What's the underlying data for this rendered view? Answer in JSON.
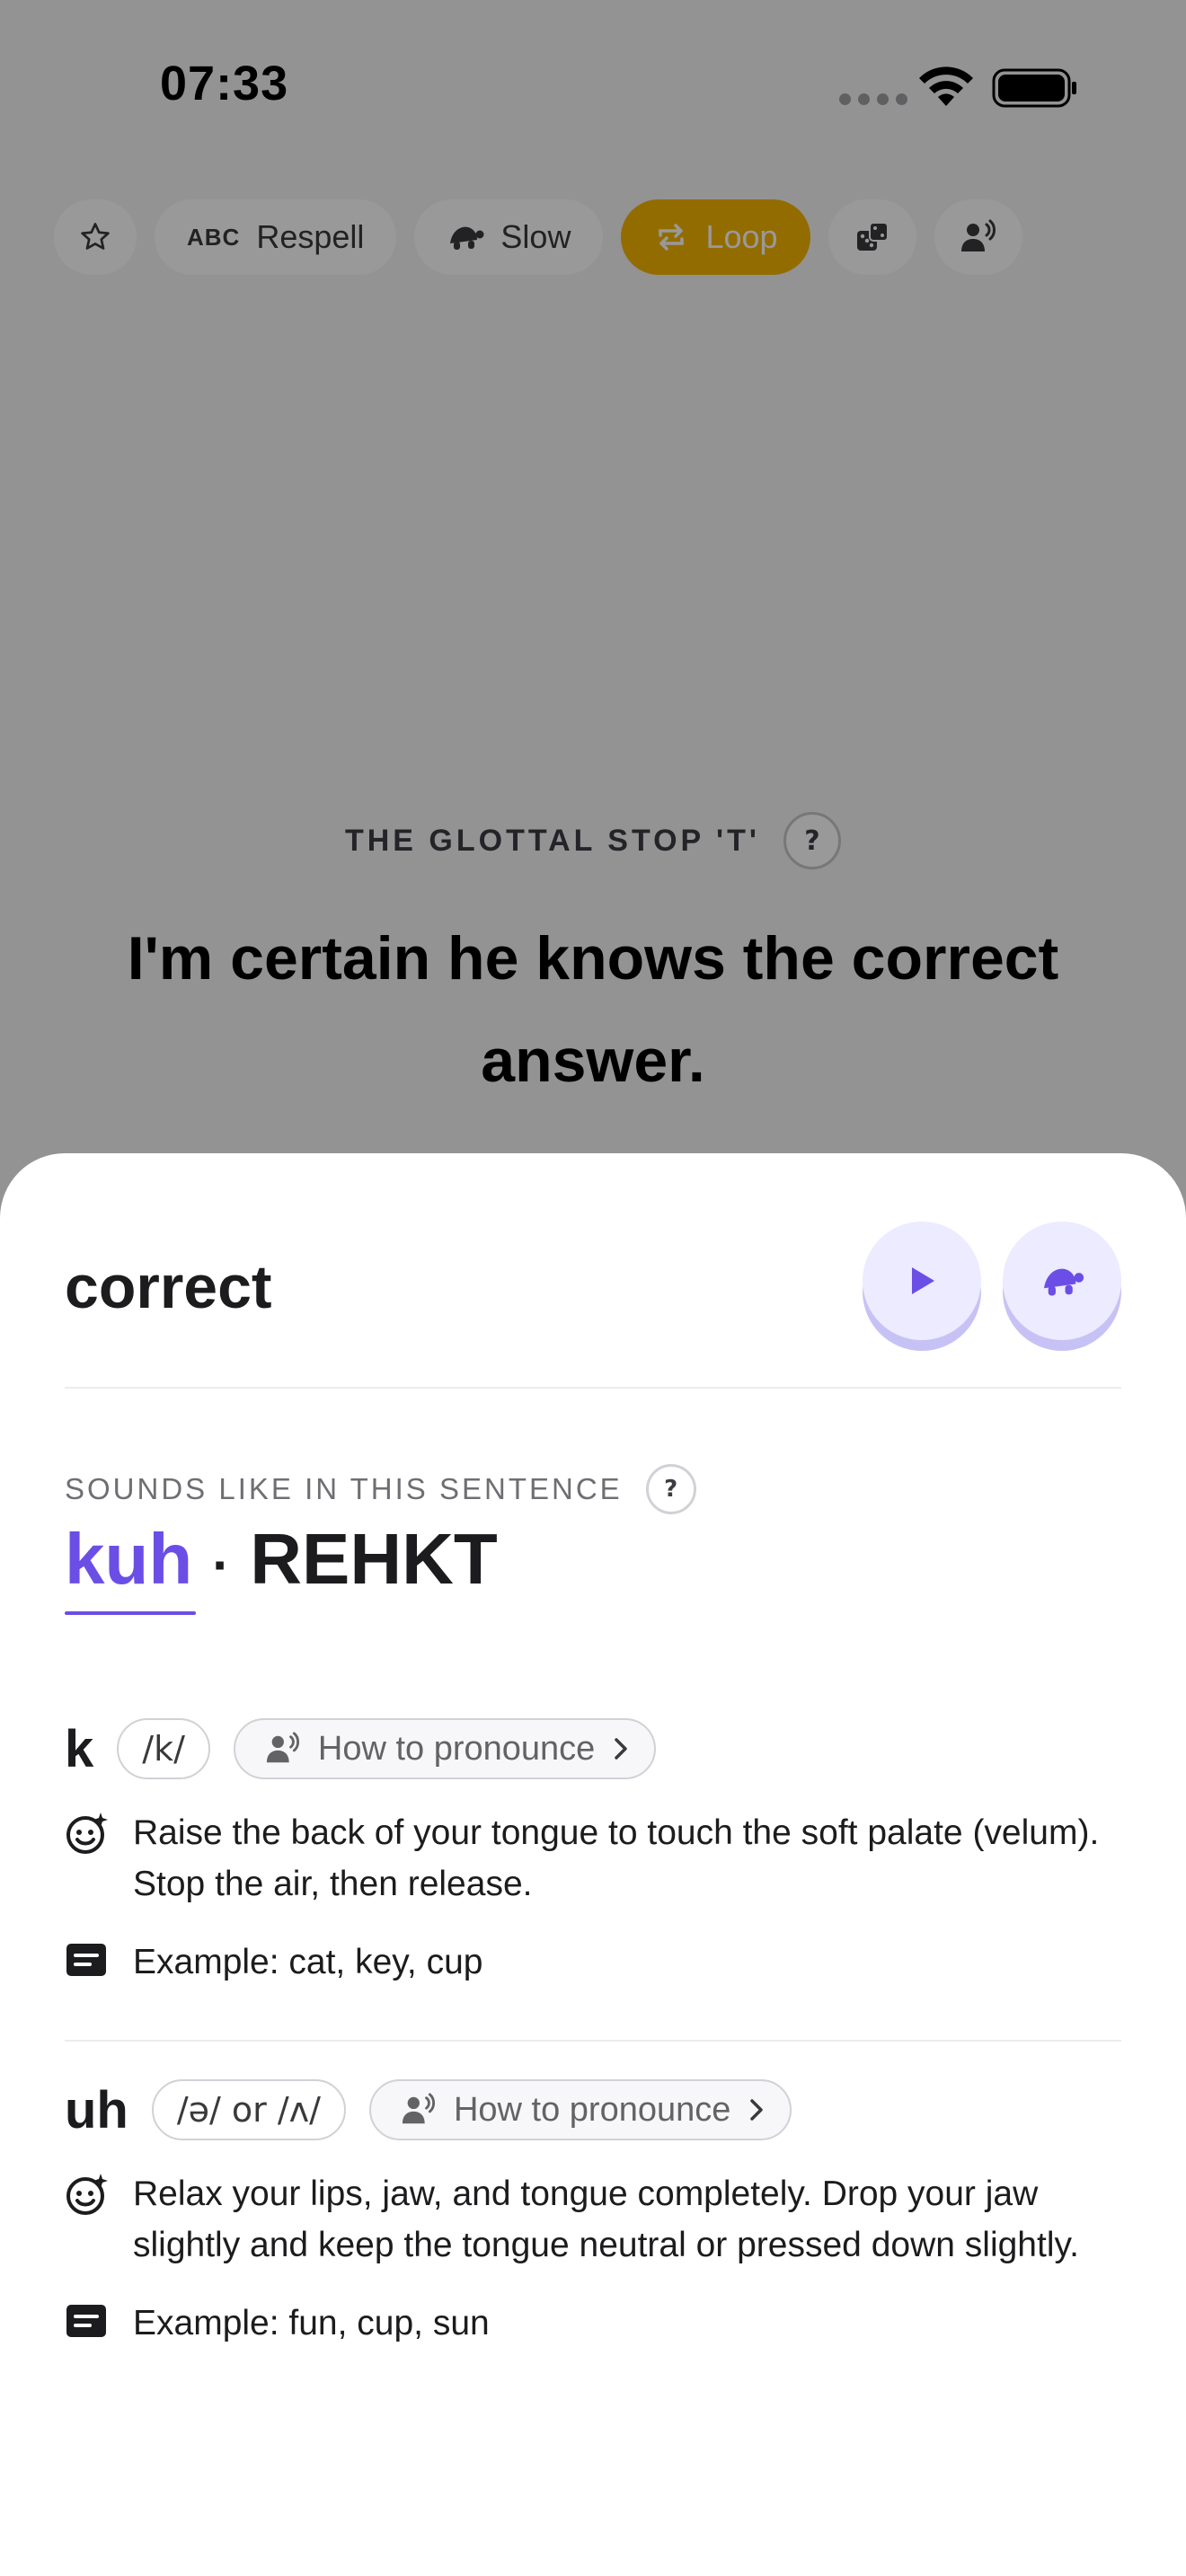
{
  "status_bar": {
    "time": "07:33"
  },
  "toolbar": {
    "favorite_icon": "star-icon",
    "respell_badge": "ABC",
    "respell_label": "Respell",
    "slow_label": "Slow",
    "loop_label": "Loop",
    "random_icon": "dice-icon",
    "speaker_icon": "speaking-person-icon",
    "active_color": "#F5B400"
  },
  "prompt": {
    "category": "THE GLOTTAL STOP 'T'",
    "help": "?",
    "sentence": "I'm certain he knows the correct answer."
  },
  "sheet": {
    "word": "correct",
    "play_icon": "play-icon",
    "slow_icon": "turtle-icon",
    "sounds_label": "SOUNDS LIKE IN THIS SENTENCE",
    "help": "?",
    "respelling": {
      "stressed_off": "kuh",
      "separator": "·",
      "stressed": "REHKT"
    },
    "accent_color": "#6B4EE6",
    "phonemes": [
      {
        "letter": "k",
        "ipa": "/k/",
        "how_label": "How to pronounce",
        "instruction": "Raise the back of your tongue to touch the soft palate (velum). Stop the air, then release.",
        "example": "Example: cat, key, cup"
      },
      {
        "letter": "uh",
        "ipa": "/ə/ or /ʌ/",
        "how_label": "How to pronounce",
        "instruction": "Relax your lips, jaw, and tongue completely. Drop your jaw slightly and keep the tongue neutral or pressed down slightly.",
        "example": "Example: fun, cup, sun"
      }
    ]
  }
}
